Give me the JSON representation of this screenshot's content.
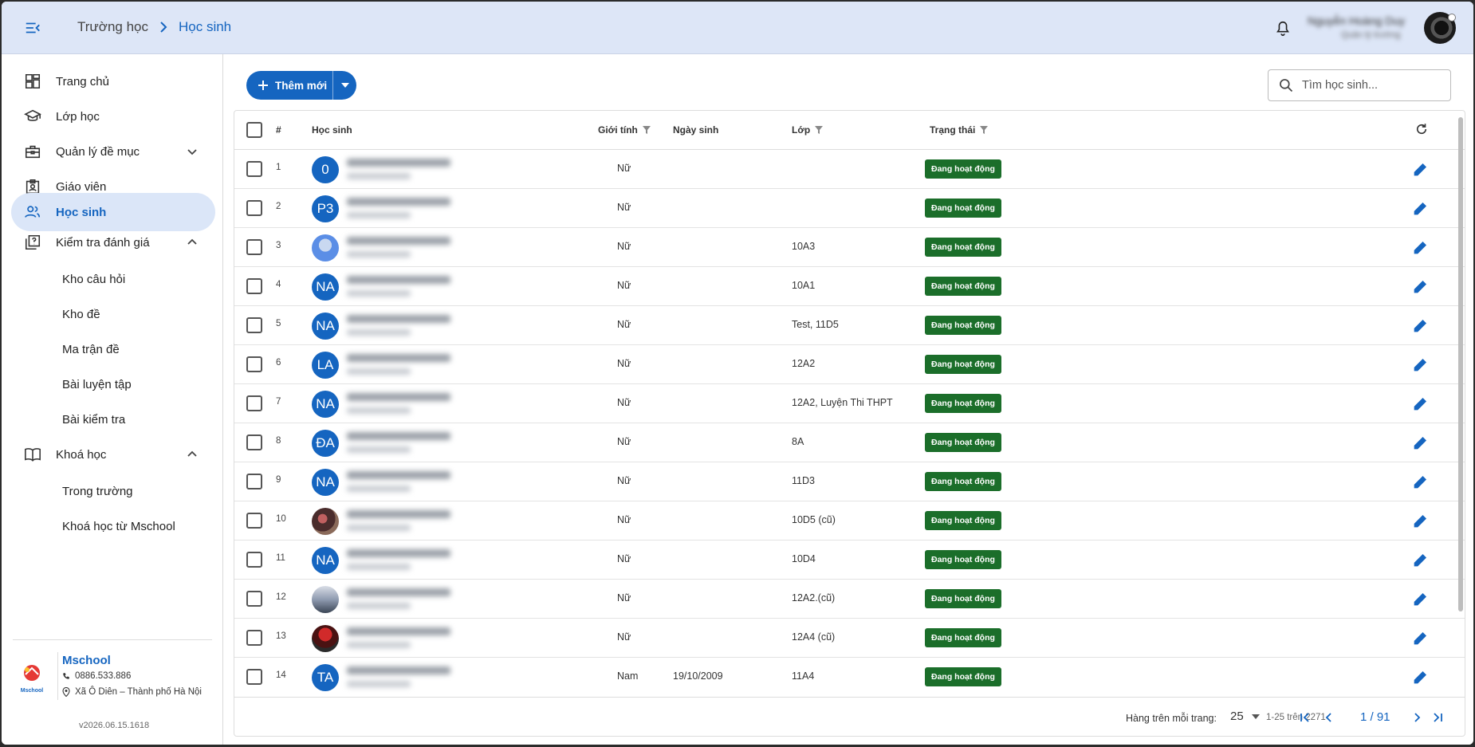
{
  "header": {
    "breadcrumb": [
      "Trường học",
      "Học sinh"
    ],
    "user_name": "Nguyễn Hoàng Duy",
    "user_role": "Quản lý trường"
  },
  "sidebar": {
    "items": [
      {
        "label": "Trang chủ",
        "icon": "dashboard-icon"
      },
      {
        "label": "Lớp học",
        "icon": "school-icon"
      },
      {
        "label": "Quản lý đề mục",
        "icon": "briefcase-icon",
        "expanded": false
      },
      {
        "label": "Giáo viên",
        "icon": "badge-icon"
      },
      {
        "label": "Học sinh",
        "icon": "people-icon",
        "active": true
      },
      {
        "label": "Kiểm tra đánh giá",
        "icon": "quiz-icon",
        "expanded": true
      },
      {
        "label": "Khoá học",
        "icon": "book-icon",
        "expanded": true
      }
    ],
    "sub_exam": [
      "Kho câu hỏi",
      "Kho đề",
      "Ma trận đề",
      "Bài luyện tập",
      "Bài kiểm tra"
    ],
    "sub_course": [
      "Trong trường",
      "Khoá học từ Mschool"
    ],
    "school": {
      "name": "Mschool",
      "phone": "0886.533.886",
      "address": "Xã Ô Diên – Thành phố Hà Nội",
      "logo_text": "Mschool"
    },
    "version": "v2026.06.15.1618"
  },
  "toolbar": {
    "add_label": "Thêm mới",
    "search_placeholder": "Tìm học sinh..."
  },
  "table": {
    "headers": {
      "stt": "#",
      "student": "Học sinh",
      "gender": "Giới tính",
      "dob": "Ngày sinh",
      "class": "Lớp",
      "status": "Trạng thái"
    },
    "rows": [
      {
        "stt": "1",
        "avatar": "0",
        "gender": "Nữ",
        "dob": "",
        "class": "",
        "status": "Đang hoạt động"
      },
      {
        "stt": "2",
        "avatar": "P3",
        "gender": "Nữ",
        "dob": "",
        "class": "",
        "status": "Đang hoạt động"
      },
      {
        "stt": "3",
        "avatar": "",
        "avatar_style": "photo1",
        "gender": "Nữ",
        "dob": "",
        "class": "10A3",
        "status": "Đang hoạt động"
      },
      {
        "stt": "4",
        "avatar": "NA",
        "gender": "Nữ",
        "dob": "",
        "class": "10A1",
        "status": "Đang hoạt động"
      },
      {
        "stt": "5",
        "avatar": "NA",
        "gender": "Nữ",
        "dob": "",
        "class": "Test, 11D5",
        "status": "Đang hoạt động"
      },
      {
        "stt": "6",
        "avatar": "LA",
        "gender": "Nữ",
        "dob": "",
        "class": "12A2",
        "status": "Đang hoạt động"
      },
      {
        "stt": "7",
        "avatar": "NA",
        "gender": "Nữ",
        "dob": "",
        "class": "12A2, Luyện Thi THPT",
        "status": "Đang hoạt động"
      },
      {
        "stt": "8",
        "avatar": "ĐA",
        "gender": "Nữ",
        "dob": "",
        "class": "8A",
        "status": "Đang hoạt động"
      },
      {
        "stt": "9",
        "avatar": "NA",
        "gender": "Nữ",
        "dob": "",
        "class": "11D3",
        "status": "Đang hoạt động"
      },
      {
        "stt": "10",
        "avatar": "",
        "avatar_style": "photo2",
        "gender": "Nữ",
        "dob": "",
        "class": "10D5 (cũ)",
        "status": "Đang hoạt động"
      },
      {
        "stt": "11",
        "avatar": "NA",
        "gender": "Nữ",
        "dob": "",
        "class": "10D4",
        "status": "Đang hoạt động"
      },
      {
        "stt": "12",
        "avatar": "",
        "avatar_style": "photo3",
        "gender": "Nữ",
        "dob": "",
        "class": "12A2.(cũ)",
        "status": "Đang hoạt động"
      },
      {
        "stt": "13",
        "avatar": "",
        "avatar_style": "photo4",
        "gender": "Nữ",
        "dob": "",
        "class": "12A4 (cũ)",
        "status": "Đang hoạt động"
      },
      {
        "stt": "14",
        "avatar": "TA",
        "gender": "Nam",
        "dob": "19/10/2009",
        "class": "11A4",
        "status": "Đang hoạt động"
      }
    ]
  },
  "pagination": {
    "rows_per_page_label": "Hàng trên mỗi trang:",
    "rows_per_page": "25",
    "range": "1-25 trên 2271",
    "page": "1 / 91"
  },
  "colors": {
    "primary": "#1565c0",
    "status_active": "#1b6e2a",
    "header_bg": "#dde6f7",
    "active_nav_bg": "#dbe6f8"
  }
}
